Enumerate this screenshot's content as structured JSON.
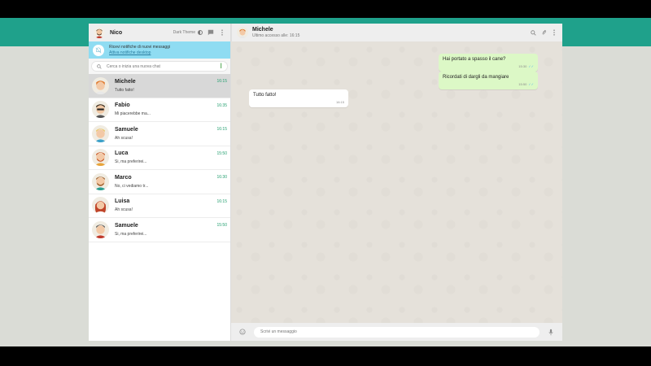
{
  "sidebar": {
    "user_name": "Nico",
    "theme_label": "Dark Theme",
    "notification": {
      "title": "Ricevi notifiche di nuovi messaggi",
      "link": "Attiva notifiche desktop"
    },
    "search": {
      "placeholder": "Cerca o inizia una nuova chat"
    },
    "chats": [
      {
        "name": "Michele",
        "time": "16:15",
        "preview": "Tutto fatto!",
        "avatar": "man-red-hair",
        "active": true
      },
      {
        "name": "Fabio",
        "time": "16:35",
        "preview": "Mi piacerebbe ma...",
        "avatar": "man-sunglasses"
      },
      {
        "name": "Samuele",
        "time": "16:15",
        "preview": "Ah scusa!",
        "avatar": "man-blonde"
      },
      {
        "name": "Luca",
        "time": "15:50",
        "preview": "Si, ma preferirei...",
        "avatar": "man-red-beard"
      },
      {
        "name": "Marco",
        "time": "16:30",
        "preview": "No, ci vediamo tr...",
        "avatar": "man-brown-beard"
      },
      {
        "name": "Luisa",
        "time": "16:15",
        "preview": "Ah scusa!",
        "avatar": "woman-red-hair"
      },
      {
        "name": "Samuele",
        "time": "15:50",
        "preview": "Si, ma preferirei...",
        "avatar": "man-grey-hair"
      }
    ]
  },
  "conversation": {
    "name": "Michele",
    "last_seen": "Ultimo accesso alle: 16:15",
    "messages": [
      {
        "text": "Hai portato a spasso il cane?",
        "time": "15:30",
        "direction": "out"
      },
      {
        "text": "Ricordati di dargli da mangiare",
        "time": "15:50",
        "direction": "out"
      },
      {
        "text": "Tutto fatto!",
        "time": "16:15",
        "direction": "in"
      }
    ],
    "composer_placeholder": "Scrivi un messaggio"
  },
  "colors": {
    "brand": "#1fa18b",
    "notification_bg": "#8fdcf2",
    "outgoing_bubble": "#dcf8c6",
    "time_accent": "#25a071"
  },
  "icons": [
    "half-circle-icon",
    "chat-icon",
    "menu-dots-icon",
    "bell-off-icon",
    "search-icon",
    "attach-icon",
    "emoji-icon",
    "microphone-icon",
    "double-check-icon"
  ]
}
